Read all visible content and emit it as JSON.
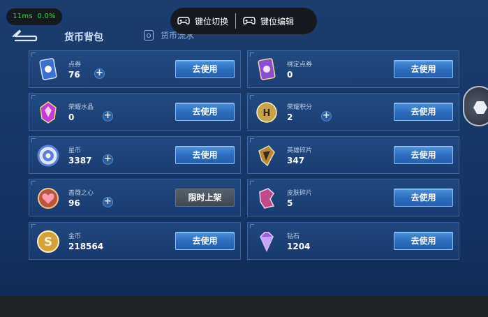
{
  "perf": {
    "latency": "11ms",
    "loss": "0.0%"
  },
  "overlay": {
    "key_switch": "键位切换",
    "key_edit": "键位编辑"
  },
  "header": {
    "tab_bag": "货币背包",
    "tab_flow": "货币流水"
  },
  "currencies": [
    {
      "name": "点券",
      "amount": "76",
      "has_plus": true,
      "button": "去使用",
      "icon": "coupon-icon",
      "color": "#3b6fd0"
    },
    {
      "name": "绑定点券",
      "amount": "0",
      "has_plus": false,
      "button": "去使用",
      "icon": "bound-coupon-icon",
      "color": "#8a4fd0"
    },
    {
      "name": "荣耀水晶",
      "amount": "0",
      "has_plus": true,
      "button": "去使用",
      "icon": "glory-crystal-icon",
      "color": "#c23bd4"
    },
    {
      "name": "荣耀积分",
      "amount": "2",
      "has_plus": true,
      "button": "去使用",
      "icon": "glory-points-icon",
      "color": "#c9a34a"
    },
    {
      "name": "星币",
      "amount": "3387",
      "has_plus": true,
      "button": "去使用",
      "icon": "star-coin-icon",
      "color": "#5a7fe0"
    },
    {
      "name": "英雄碎片",
      "amount": "347",
      "has_plus": false,
      "button": "去使用",
      "icon": "hero-fragment-icon",
      "color": "#b8893a"
    },
    {
      "name": "蔷薇之心",
      "amount": "96",
      "has_plus": true,
      "button": "限时上架",
      "icon": "rose-heart-icon",
      "color": "#b8553a"
    },
    {
      "name": "皮肤碎片",
      "amount": "5",
      "has_plus": false,
      "button": "去使用",
      "icon": "skin-fragment-icon",
      "color": "#c04a8a"
    },
    {
      "name": "金币",
      "amount": "218564",
      "has_plus": false,
      "button": "去使用",
      "icon": "gold-coin-icon",
      "color": "#d4a23a"
    },
    {
      "name": "钻石",
      "amount": "1204",
      "has_plus": false,
      "button": "去使用",
      "icon": "diamond-icon",
      "color": "#9b5fe0"
    }
  ]
}
